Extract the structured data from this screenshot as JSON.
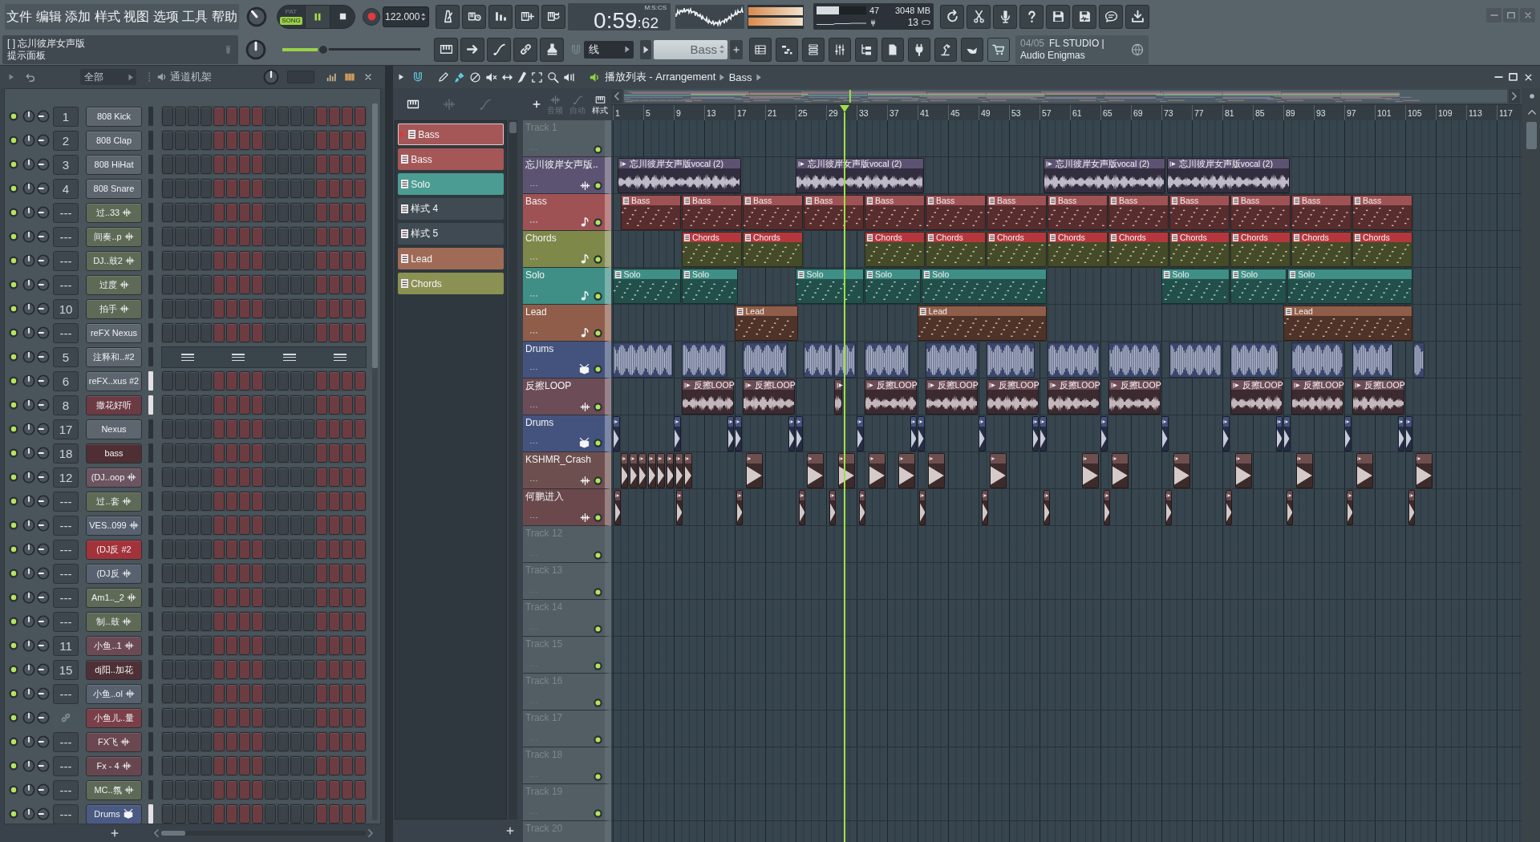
{
  "menu": [
    "文件",
    "编辑",
    "添加",
    "样式",
    "视图",
    "选项",
    "工具",
    "帮助"
  ],
  "hint_panel": {
    "title": "[ ] 忘川彼岸女声版",
    "caption": "提示面板"
  },
  "transport": {
    "modes": [
      {
        "label": "PAT",
        "selected": false
      },
      {
        "label": "SONG",
        "selected": true
      }
    ],
    "playing": true,
    "tempo": "122.000"
  },
  "master": {
    "volume": {
      "level": 0.28
    }
  },
  "time": {
    "main": "0:59",
    "fraction": ":62",
    "unit": "M:S:CS"
  },
  "performance": {
    "cpu": {
      "level": 0.45
    },
    "cpu_reading": "47",
    "memory": "3048 MB",
    "polyphony": "13"
  },
  "snap": {
    "value": "线"
  },
  "pattern_selector": {
    "value": "Bass"
  },
  "news": {
    "date": "04/05",
    "text": "FL STUDIO | Audio Enigmas"
  },
  "channel_rack": {
    "filter": "全部",
    "title": "通道机架",
    "channels": [
      {
        "number": "1",
        "name": "808 Kick",
        "kind": "plugin",
        "color": "#5d666e",
        "on": true,
        "selected": false,
        "piano_roll": false
      },
      {
        "number": "2",
        "name": "808 Clap",
        "kind": "plugin",
        "color": "#5d666e",
        "on": true,
        "selected": false,
        "piano_roll": false
      },
      {
        "number": "3",
        "name": "808 HiHat",
        "kind": "plugin",
        "color": "#5d666e",
        "on": true,
        "selected": false,
        "piano_roll": false
      },
      {
        "number": "4",
        "name": "808 Snare",
        "kind": "plugin",
        "color": "#5d666e",
        "on": true,
        "selected": false,
        "piano_roll": false
      },
      {
        "number": "---",
        "name": "过..33",
        "kind": "audio",
        "color": "#5e6a56",
        "on": true,
        "selected": false,
        "piano_roll": false
      },
      {
        "number": "---",
        "name": "间奏..p",
        "kind": "audio",
        "color": "#5e6a56",
        "on": true,
        "selected": false,
        "piano_roll": false
      },
      {
        "number": "---",
        "name": "DJ..鼓2",
        "kind": "audio",
        "color": "#5e6a56",
        "on": true,
        "selected": false,
        "piano_roll": false
      },
      {
        "number": "---",
        "name": "过度",
        "kind": "audio",
        "color": "#5e6a56",
        "on": true,
        "selected": false,
        "piano_roll": false
      },
      {
        "number": "10",
        "name": "拍手",
        "kind": "audio",
        "color": "#5e6a56",
        "on": true,
        "selected": false,
        "piano_roll": false
      },
      {
        "number": "---",
        "name": "reFX Nexus",
        "kind": "plugin",
        "color": "#5d666e",
        "on": true,
        "selected": false,
        "piano_roll": false
      },
      {
        "number": "5",
        "name": "注释和..#2",
        "kind": "plugin",
        "color": "#5d666e",
        "on": true,
        "selected": false,
        "piano_roll": true
      },
      {
        "number": "6",
        "name": "reFX..xus #2",
        "kind": "plugin",
        "color": "#5d666e",
        "on": true,
        "selected": true,
        "piano_roll": false
      },
      {
        "number": "8",
        "name": "撒花好听",
        "kind": "plugin",
        "color": "#6b3a43",
        "on": true,
        "selected": true,
        "piano_roll": false
      },
      {
        "number": "17",
        "name": "Nexus",
        "kind": "plugin",
        "color": "#5d666e",
        "on": true,
        "selected": false,
        "piano_roll": false
      },
      {
        "number": "18",
        "name": "bass",
        "kind": "plugin",
        "color": "#4f2e34",
        "on": true,
        "selected": false,
        "piano_roll": false
      },
      {
        "number": "12",
        "name": "(DJ..oop",
        "kind": "audio",
        "color": "#6c5560",
        "on": true,
        "selected": false,
        "piano_roll": false
      },
      {
        "number": "---",
        "name": "过..套",
        "kind": "audio",
        "color": "#5e6a56",
        "on": true,
        "selected": false,
        "piano_roll": false
      },
      {
        "number": "---",
        "name": "VES..099",
        "kind": "audio",
        "color": "#57616f",
        "on": true,
        "selected": false,
        "piano_roll": false
      },
      {
        "number": "---",
        "name": "(DJ反 #2",
        "kind": "plugin",
        "color": "#a3333b",
        "on": true,
        "selected": false,
        "piano_roll": false
      },
      {
        "number": "---",
        "name": "(DJ反",
        "kind": "audio",
        "color": "#57616f",
        "on": true,
        "selected": false,
        "piano_roll": false
      },
      {
        "number": "---",
        "name": "Am1.._2",
        "kind": "audio",
        "color": "#5e6a56",
        "on": true,
        "selected": false,
        "piano_roll": false
      },
      {
        "number": "---",
        "name": "制..鼓",
        "kind": "audio",
        "color": "#5e6a56",
        "on": true,
        "selected": false,
        "piano_roll": false
      },
      {
        "number": "11",
        "name": "小鱼..1",
        "kind": "audio",
        "color": "#6c4a55",
        "on": true,
        "selected": false,
        "piano_roll": false
      },
      {
        "number": "15",
        "name": "dj阳..加花",
        "kind": "plugin",
        "color": "#4f3036",
        "on": true,
        "selected": false,
        "piano_roll": false
      },
      {
        "number": "---",
        "name": "小鱼..ol",
        "kind": "audio",
        "color": "#57616f",
        "on": true,
        "selected": false,
        "piano_roll": false
      },
      {
        "name": "小鱼儿..量",
        "kind": "plugin",
        "color": "#7a3f48",
        "on": true,
        "selected": false,
        "piano_roll": false
      },
      {
        "number": "---",
        "name": "FX飞",
        "kind": "audio",
        "color": "#6a4751",
        "on": true,
        "selected": false,
        "piano_roll": false
      },
      {
        "number": "---",
        "name": "Fx - 4",
        "kind": "audio",
        "color": "#67474f",
        "on": true,
        "selected": false,
        "piano_roll": false
      },
      {
        "number": "---",
        "name": "MC..氛",
        "kind": "audio",
        "color": "#5e6a56",
        "on": true,
        "selected": false,
        "piano_roll": false
      },
      {
        "number": "---",
        "name": "Drums",
        "kind": "drums",
        "color": "#4a5a82",
        "on": true,
        "selected": true,
        "piano_roll": false
      }
    ]
  },
  "playlist": {
    "title": "播放列表 - Arrangement",
    "pattern": "Bass",
    "tools": [
      {
        "kind": "play",
        "selected": false
      },
      {
        "kind": "snap",
        "selected": true
      },
      {
        "kind": "draw",
        "selected": false
      },
      {
        "kind": "paint",
        "selected": true
      },
      {
        "kind": "delete",
        "selected": false
      },
      {
        "kind": "mute",
        "selected": false
      },
      {
        "kind": "slip",
        "selected": false
      },
      {
        "kind": "slice",
        "selected": false
      },
      {
        "kind": "select",
        "selected": false
      },
      {
        "kind": "zoom",
        "selected": false
      },
      {
        "kind": "playback",
        "selected": false
      }
    ],
    "picker_tabs": [
      {
        "kind": "patterns",
        "selected": true
      },
      {
        "kind": "audio",
        "selected": false
      },
      {
        "kind": "automation",
        "selected": false
      }
    ],
    "patterns": [
      {
        "label": "Bass",
        "color": "#a55757",
        "selected": true
      },
      {
        "label": "Bass",
        "color": "#a55757",
        "selected": false
      },
      {
        "label": "Solo",
        "color": "#4b9c92",
        "selected": false
      },
      {
        "label": "样式 4",
        "color": "#3f4a52",
        "selected": false
      },
      {
        "label": "样式 5",
        "color": "#3f4a52",
        "selected": false
      },
      {
        "label": "Lead",
        "color": "#a06b56",
        "selected": false
      },
      {
        "label": "Chords",
        "color": "#8a9152",
        "selected": false
      }
    ],
    "filters": [
      {
        "kind": "audio",
        "label": "音频",
        "selected": false
      },
      {
        "kind": "automation",
        "label": "自动",
        "selected": false
      },
      {
        "kind": "pattern",
        "label": "样式",
        "selected": true
      }
    ],
    "ruler": [
      "1",
      "5",
      "9",
      "13",
      "17",
      "21",
      "25",
      "29",
      "33",
      "37",
      "41",
      "45",
      "49",
      "53",
      "57",
      "61",
      "65",
      "69",
      "73",
      "77",
      "81",
      "85",
      "89",
      "93",
      "97",
      "101",
      "105",
      "109",
      "113",
      "117"
    ],
    "song_position": {
      "level": 0.256
    },
    "tracks": [
      {
        "name": "Track 1",
        "kind": "empty",
        "on": true
      },
      {
        "name": "忘川彼岸女声版..",
        "kind": "audio",
        "color": "#5c5372",
        "on": true,
        "clips": [
          {
            "kind": "audio",
            "label": "忘川彼岸女声版vocal (2)",
            "selected": false
          },
          {
            "kind": "audio",
            "label": "忘川彼岸女声版vocal (2)",
            "selected": false
          },
          {
            "kind": "audio",
            "label": "忘川彼岸女声版vocal (2)",
            "selected": false
          },
          {
            "kind": "audio",
            "label": "忘川彼岸女声版vocal (2)",
            "selected": false
          }
        ]
      },
      {
        "name": "Bass",
        "kind": "pattern",
        "color": "#9f5254",
        "on": true,
        "clips": [
          {
            "kind": "pattern",
            "label": "Bass",
            "selected": false
          },
          {
            "kind": "pattern",
            "label": "Bass",
            "selected": false
          },
          {
            "kind": "pattern",
            "label": "Bass",
            "selected": false
          },
          {
            "kind": "pattern",
            "label": "Bass",
            "selected": false
          },
          {
            "kind": "pattern",
            "label": "Bass",
            "selected": false
          },
          {
            "kind": "pattern",
            "label": "Bass",
            "selected": false
          },
          {
            "kind": "pattern",
            "label": "Bass",
            "selected": false
          },
          {
            "kind": "pattern",
            "label": "Bass",
            "selected": false
          },
          {
            "kind": "pattern",
            "label": "Bass",
            "selected": false
          },
          {
            "kind": "pattern",
            "label": "Bass",
            "selected": false
          },
          {
            "kind": "pattern",
            "label": "Bass",
            "selected": false
          },
          {
            "kind": "pattern",
            "label": "Bass",
            "selected": false
          },
          {
            "kind": "pattern",
            "label": "Bass",
            "selected": false
          }
        ]
      },
      {
        "name": "Chords",
        "kind": "pattern",
        "color": "#7e8849",
        "on": true,
        "clips": [
          {
            "kind": "pattern",
            "label": "Chords",
            "selected": true
          },
          {
            "kind": "pattern",
            "label": "Chords",
            "selected": true
          },
          {
            "kind": "pattern",
            "label": "Chords",
            "selected": true
          },
          {
            "kind": "pattern",
            "label": "Chords",
            "selected": true
          },
          {
            "kind": "pattern",
            "label": "Chords",
            "selected": true
          },
          {
            "kind": "pattern",
            "label": "Chords",
            "selected": true
          },
          {
            "kind": "pattern",
            "label": "Chords",
            "selected": true
          },
          {
            "kind": "pattern",
            "label": "Chords",
            "selected": true
          },
          {
            "kind": "pattern",
            "label": "Chords",
            "selected": true
          },
          {
            "kind": "pattern",
            "label": "Chords",
            "selected": true
          },
          {
            "kind": "pattern",
            "label": "Chords",
            "selected": true
          }
        ]
      },
      {
        "name": "Solo",
        "kind": "pattern",
        "color": "#3f8f86",
        "on": true,
        "clips": [
          {
            "kind": "pattern",
            "label": "Solo",
            "selected": false
          },
          {
            "kind": "pattern",
            "label": "Solo",
            "selected": false
          },
          {
            "kind": "pattern",
            "label": "Solo",
            "selected": false
          },
          {
            "kind": "pattern",
            "label": "Solo",
            "selected": false
          },
          {
            "kind": "pattern",
            "label": "Solo",
            "selected": false
          },
          {
            "kind": "pattern",
            "label": "Solo",
            "selected": false
          },
          {
            "kind": "pattern",
            "label": "Solo",
            "selected": false
          },
          {
            "kind": "pattern",
            "label": "Solo",
            "selected": false
          }
        ]
      },
      {
        "name": "Lead",
        "kind": "pattern",
        "color": "#8f5d49",
        "on": true,
        "clips": [
          {
            "kind": "pattern",
            "label": "Lead",
            "selected": false
          },
          {
            "kind": "pattern",
            "label": "Lead",
            "selected": false
          },
          {
            "kind": "pattern",
            "label": "Lead",
            "selected": false
          }
        ]
      },
      {
        "name": "Drums",
        "kind": "drums",
        "color": "#44527e",
        "on": true,
        "clips": [
          {
            "kind": "hits",
            "selected": false
          },
          {
            "kind": "hits",
            "selected": false
          },
          {
            "kind": "hits",
            "selected": false
          },
          {
            "kind": "hits",
            "selected": false
          },
          {
            "kind": "hits",
            "selected": false
          },
          {
            "kind": "hits",
            "selected": false
          },
          {
            "kind": "hits",
            "selected": false
          },
          {
            "kind": "hits",
            "selected": false
          },
          {
            "kind": "hits",
            "selected": false
          },
          {
            "kind": "hits",
            "selected": false
          },
          {
            "kind": "hits",
            "selected": false
          },
          {
            "kind": "hits",
            "selected": false
          },
          {
            "kind": "hits",
            "selected": false
          },
          {
            "kind": "hits",
            "selected": false
          },
          {
            "kind": "hits",
            "selected": false
          }
        ]
      },
      {
        "name": "反擦LOOP",
        "kind": "audio",
        "color": "#6c4c56",
        "on": true,
        "clips": [
          {
            "kind": "audio",
            "label": "反擦LOOP",
            "selected": false
          },
          {
            "kind": "audio",
            "label": "反擦LOOP",
            "selected": false
          },
          {
            "kind": "audio",
            "selected": false
          },
          {
            "kind": "audio",
            "label": "反擦LOOP",
            "selected": false
          },
          {
            "kind": "audio",
            "label": "反擦LOOP",
            "selected": false
          },
          {
            "kind": "audio",
            "label": "反擦LOOP",
            "selected": false
          },
          {
            "kind": "audio",
            "label": "反擦LOOP",
            "selected": false
          },
          {
            "kind": "audio",
            "label": "反擦LOOP",
            "selected": false
          },
          {
            "kind": "audio",
            "label": "反擦LOOP",
            "selected": false
          },
          {
            "kind": "audio",
            "label": "反擦LOOP",
            "selected": false
          },
          {
            "kind": "audio",
            "label": "反擦LOOP",
            "selected": false
          }
        ]
      },
      {
        "name": "Drums",
        "kind": "drums",
        "color": "#44527e",
        "on": true,
        "clips": [
          {
            "kind": "oneshot",
            "selected": false
          },
          {
            "kind": "oneshot",
            "selected": false
          },
          {
            "kind": "oneshot",
            "selected": false
          },
          {
            "kind": "oneshot",
            "selected": false
          },
          {
            "kind": "oneshot",
            "selected": false
          },
          {
            "kind": "oneshot",
            "selected": false
          },
          {
            "kind": "oneshot",
            "selected": false
          },
          {
            "kind": "oneshot",
            "selected": false
          },
          {
            "kind": "oneshot",
            "selected": false
          },
          {
            "kind": "oneshot",
            "selected": false
          },
          {
            "kind": "oneshot",
            "selected": false
          },
          {
            "kind": "oneshot",
            "selected": false
          },
          {
            "kind": "oneshot",
            "selected": false
          },
          {
            "kind": "oneshot",
            "selected": false
          },
          {
            "kind": "oneshot",
            "selected": false
          },
          {
            "kind": "oneshot",
            "selected": false
          },
          {
            "kind": "oneshot",
            "selected": false
          },
          {
            "kind": "oneshot",
            "selected": false
          },
          {
            "kind": "oneshot",
            "selected": false
          },
          {
            "kind": "oneshot",
            "selected": false
          }
        ]
      },
      {
        "name": "KSHMR_Crash",
        "kind": "audio",
        "color": "#6e4f4f",
        "on": true,
        "clips": [
          {
            "kind": "oneshot",
            "selected": false
          },
          {
            "kind": "oneshot",
            "selected": false
          },
          {
            "kind": "oneshot",
            "selected": false
          },
          {
            "kind": "oneshot",
            "selected": false
          },
          {
            "kind": "oneshot",
            "selected": false
          },
          {
            "kind": "oneshot",
            "selected": false
          },
          {
            "kind": "oneshot",
            "selected": false
          },
          {
            "kind": "oneshot",
            "selected": false
          },
          {
            "kind": "oneshot",
            "selected": false
          },
          {
            "kind": "oneshot",
            "selected": false
          },
          {
            "kind": "oneshot",
            "selected": false
          },
          {
            "kind": "oneshot",
            "selected": false
          },
          {
            "kind": "oneshot",
            "selected": false
          },
          {
            "kind": "oneshot",
            "selected": false
          },
          {
            "kind": "oneshot",
            "selected": false
          },
          {
            "kind": "oneshot",
            "selected": false
          },
          {
            "kind": "oneshot",
            "selected": false
          },
          {
            "kind": "oneshot",
            "selected": false
          },
          {
            "kind": "oneshot",
            "selected": false
          },
          {
            "kind": "oneshot",
            "selected": false
          },
          {
            "kind": "oneshot",
            "selected": false
          },
          {
            "kind": "oneshot",
            "selected": false
          }
        ]
      },
      {
        "name": "何鹏进入",
        "kind": "audio",
        "color": "#6a484c",
        "on": true,
        "clips": [
          {
            "kind": "oneshot",
            "selected": false
          },
          {
            "kind": "oneshot",
            "selected": false
          },
          {
            "kind": "oneshot",
            "selected": false
          },
          {
            "kind": "oneshot",
            "selected": false
          },
          {
            "kind": "oneshot",
            "selected": false
          },
          {
            "kind": "oneshot",
            "selected": false
          },
          {
            "kind": "oneshot",
            "selected": false
          },
          {
            "kind": "oneshot",
            "selected": false
          },
          {
            "kind": "oneshot",
            "selected": false
          },
          {
            "kind": "oneshot",
            "selected": false
          },
          {
            "kind": "oneshot",
            "selected": false
          },
          {
            "kind": "oneshot",
            "selected": false
          },
          {
            "kind": "oneshot",
            "selected": false
          },
          {
            "kind": "oneshot",
            "selected": false
          },
          {
            "kind": "oneshot",
            "selected": false
          }
        ]
      },
      {
        "name": "Track 12",
        "kind": "empty",
        "on": true
      },
      {
        "name": "Track 13",
        "kind": "empty",
        "on": true
      },
      {
        "name": "Track 14",
        "kind": "empty",
        "on": true
      },
      {
        "name": "Track 15",
        "kind": "empty",
        "on": true
      },
      {
        "name": "Track 16",
        "kind": "empty",
        "on": true
      },
      {
        "name": "Track 17",
        "kind": "empty",
        "on": true
      },
      {
        "name": "Track 18",
        "kind": "empty",
        "on": true
      },
      {
        "name": "Track 19",
        "kind": "empty",
        "on": true
      },
      {
        "name": "Track 20",
        "kind": "empty"
      }
    ]
  }
}
